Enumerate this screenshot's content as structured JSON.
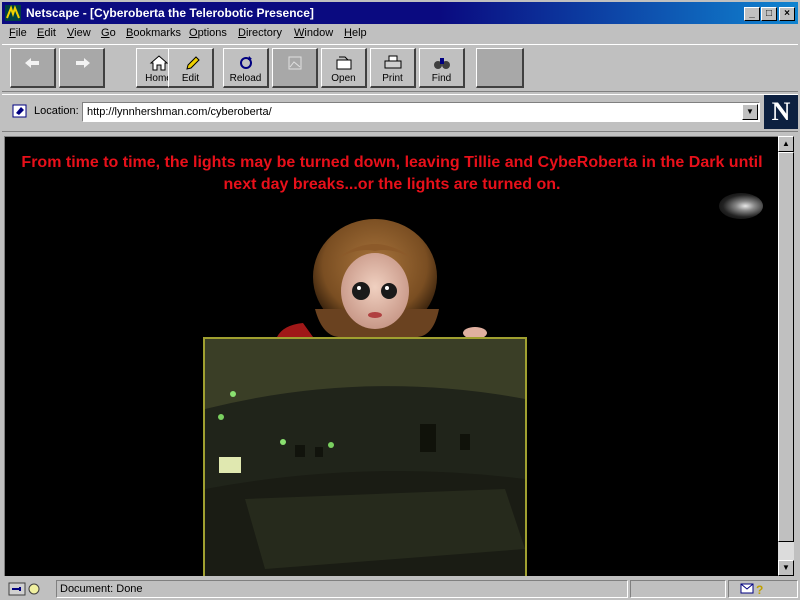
{
  "window": {
    "title": "Netscape - [Cyberoberta the Telerobotic Presence]"
  },
  "menu": {
    "items": [
      {
        "label": "File",
        "key": "F",
        "rest": "ile"
      },
      {
        "label": "Edit",
        "key": "E",
        "rest": "dit"
      },
      {
        "label": "View",
        "key": "V",
        "rest": "iew"
      },
      {
        "label": "Go",
        "key": "G",
        "rest": "o"
      },
      {
        "label": "Bookmarks",
        "key": "B",
        "rest": "ookmarks"
      },
      {
        "label": "Options",
        "key": "O",
        "rest": "ptions"
      },
      {
        "label": "Directory",
        "key": "D",
        "rest": "irectory"
      },
      {
        "label": "Window",
        "key": "W",
        "rest": "indow"
      },
      {
        "label": "Help",
        "key": "H",
        "rest": "elp"
      }
    ]
  },
  "toolbar": {
    "home": "Home",
    "edit": "Edit",
    "reload": "Reload",
    "open": "Open",
    "print": "Print",
    "find": "Find"
  },
  "location": {
    "label": "Location:",
    "url": "http://lynnhershman.com/cyberoberta/"
  },
  "content": {
    "headline": "From time to time, the lights may be turned down, leaving Tillie and CybeRoberta in the Dark until next day breaks...or the lights are turned on."
  },
  "status": {
    "text": "Document: Done"
  },
  "colors": {
    "headline": "#e8101a",
    "titlebar": "#0a0a80",
    "frame": "#a0a030"
  }
}
